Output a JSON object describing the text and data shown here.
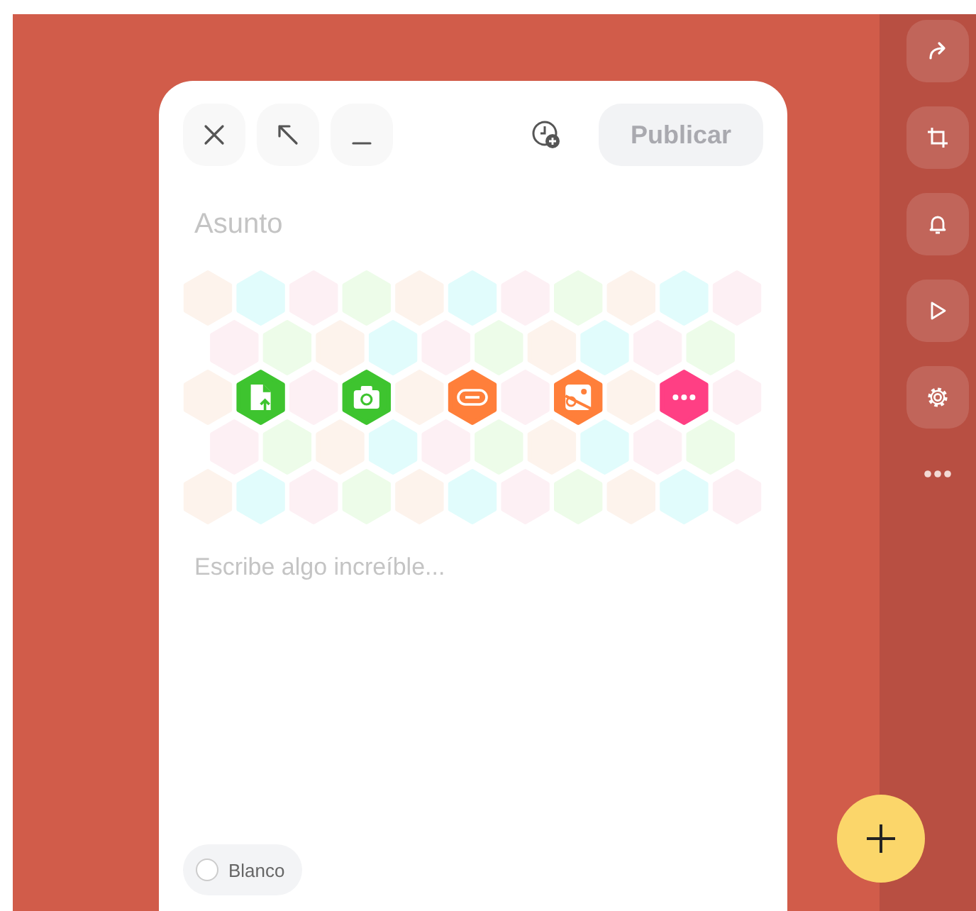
{
  "toolbar": {
    "buttons": [
      {
        "kind": "close"
      },
      {
        "kind": "expand"
      },
      {
        "kind": "minimize"
      }
    ],
    "publish_button": {
      "label": "Publicar",
      "disabled": true
    }
  },
  "subject": {
    "placeholder": "Asunto"
  },
  "attachments": [
    {
      "kind": "file",
      "color": "#3ec42f"
    },
    {
      "kind": "camera",
      "color": "#3ec42f"
    },
    {
      "kind": "link",
      "color": "#ff7f3a"
    },
    {
      "kind": "image",
      "color": "#ff7f3a"
    },
    {
      "kind": "more",
      "color": "#ff3f84"
    }
  ],
  "body": {
    "placeholder": "Escribe algo increíble..."
  },
  "background_option": {
    "label": "Blanco",
    "selected": false
  },
  "side_actions": [
    {
      "kind": "share"
    },
    {
      "kind": "crop"
    },
    {
      "kind": "bell"
    },
    {
      "kind": "play"
    },
    {
      "kind": "settings"
    },
    {
      "kind": "more"
    }
  ]
}
